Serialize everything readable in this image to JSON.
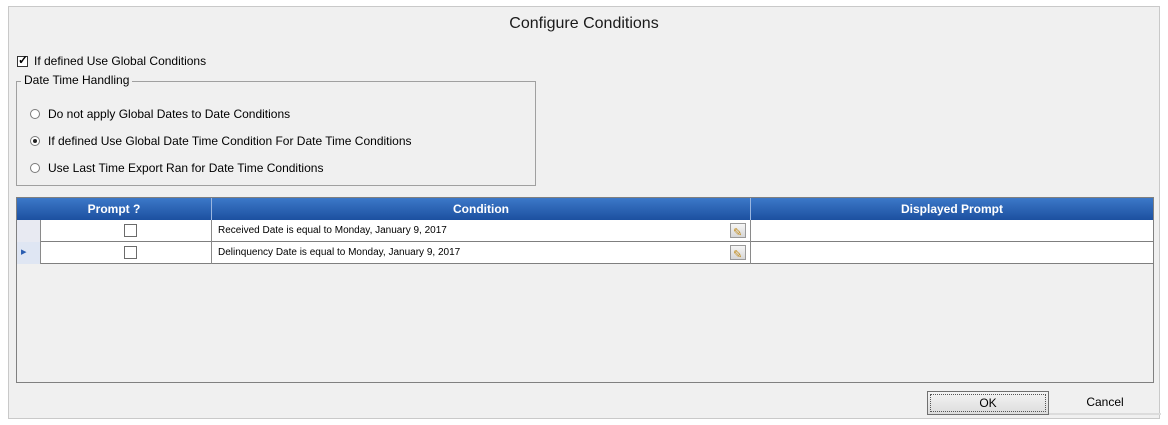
{
  "dialog": {
    "title": "Configure Conditions"
  },
  "global_conditions": {
    "label": "If defined Use Global Conditions",
    "checked": true
  },
  "date_time_handling": {
    "group_label": "Date Time Handling",
    "options": [
      {
        "label": "Do not apply Global Dates to Date Conditions",
        "selected": false
      },
      {
        "label": "If defined Use Global Date Time Condition For Date Time Conditions",
        "selected": true
      },
      {
        "label": "Use Last Time Export Ran for Date Time Conditions",
        "selected": false
      }
    ]
  },
  "grid": {
    "columns": [
      "Prompt ?",
      "Condition",
      "Displayed Prompt"
    ],
    "rows": [
      {
        "prompt": false,
        "condition": "Received Date is equal to Monday, January 9, 2017",
        "displayed_prompt": ""
      },
      {
        "prompt": false,
        "condition": "Delinquency Date is equal to Monday, January 9, 2017",
        "displayed_prompt": ""
      }
    ]
  },
  "buttons": {
    "ok": "OK",
    "cancel": "Cancel"
  }
}
